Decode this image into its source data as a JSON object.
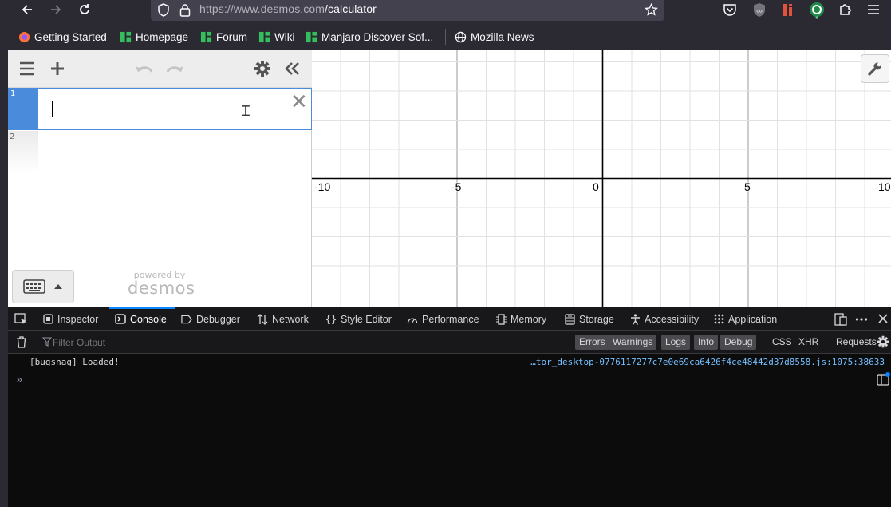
{
  "browser": {
    "url_host": "https://www.desmos.com",
    "url_path": "/calculator"
  },
  "bookmarks": [
    {
      "label": "Getting Started"
    },
    {
      "label": "Homepage"
    },
    {
      "label": "Forum"
    },
    {
      "label": "Wiki"
    },
    {
      "label": "Manjaro Discover Sof..."
    },
    {
      "label": "Mozilla News"
    }
  ],
  "desmos": {
    "rows": [
      {
        "number": "1"
      },
      {
        "number": "2"
      }
    ],
    "powered_by": "powered by",
    "logo": "desmos",
    "graph": {
      "x_ticks": [
        "-10",
        "-5",
        "0",
        "5",
        "10"
      ]
    }
  },
  "devtools": {
    "tabs": [
      {
        "label": "Inspector"
      },
      {
        "label": "Console"
      },
      {
        "label": "Debugger"
      },
      {
        "label": "Network"
      },
      {
        "label": "Style Editor"
      },
      {
        "label": "Performance"
      },
      {
        "label": "Memory"
      },
      {
        "label": "Storage"
      },
      {
        "label": "Accessibility"
      },
      {
        "label": "Application"
      }
    ],
    "selected_tab": "Console",
    "filter_placeholder": "Filter Output",
    "levels": [
      "Errors",
      "Warnings",
      "Logs",
      "Info",
      "Debug"
    ],
    "types": [
      "CSS",
      "XHR",
      "Requests"
    ],
    "messages": [
      {
        "text": "[bugsnag] Loaded!",
        "source": "…tor_desktop-0776117277c7e0e69ca6426f4ce48442d37d8558.js:1075:38633"
      }
    ],
    "prompt": "»"
  },
  "colors": {
    "accent": "#4b8bdb",
    "devtools_selected": "#0a84ff"
  }
}
